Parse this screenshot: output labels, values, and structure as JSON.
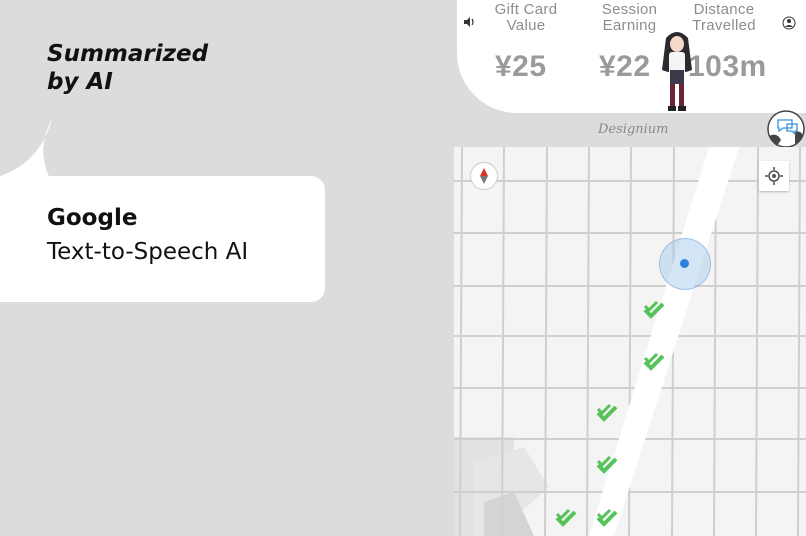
{
  "overlay": {
    "summary_text": "Summarized\nby AI",
    "bubble_title": "Google",
    "bubble_subtitle": "Text-to-Speech AI"
  },
  "stats": {
    "gift_card_label": "Gift Card\nValue",
    "gift_card_value": "¥25",
    "session_label": "Session\nEarning",
    "session_value": "¥22",
    "distance_label": "Distance\nTravelled",
    "distance_value": "103m"
  },
  "brand": {
    "designium": "Designium"
  },
  "icons": {
    "speaker": "speaker-icon",
    "compass": "compass-icon",
    "locate": "crosshair-icon",
    "checkpoint": "checkpoint-check-icon"
  },
  "colors": {
    "background": "#dcdcdc",
    "stat_value": "#9a9a9a",
    "map_grid": "#c8c8c8",
    "user_location": "#2f7fdf",
    "checkpoint": "#55c35a"
  }
}
